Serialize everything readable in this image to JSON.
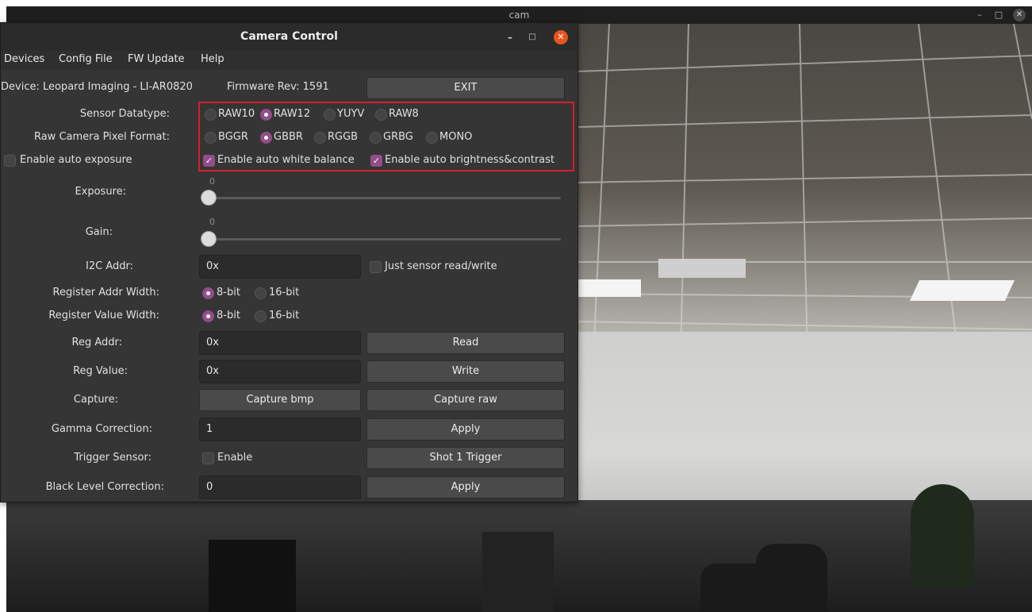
{
  "cam_window": {
    "title": "cam",
    "min_glyph": "–",
    "max_glyph": "□",
    "close_glyph": "✕"
  },
  "dialog": {
    "title": "Camera Control",
    "min_glyph": "–",
    "max_glyph": "□",
    "close_glyph": "✕"
  },
  "menu": [
    "Devices",
    "Config File",
    "FW Update",
    "Help"
  ],
  "device_info": {
    "device": "Device: Leopard Imaging - LI-AR0820",
    "firmware": "Firmware Rev: 1591",
    "exit_label": "EXIT"
  },
  "sensor_datatype": {
    "label": "Sensor Datatype:",
    "options": [
      "RAW10",
      "RAW12",
      "YUYV",
      "RAW8"
    ],
    "selected": "RAW12"
  },
  "pixel_format": {
    "label": "Raw Camera Pixel Format:",
    "options": [
      "BGGR",
      "GBBR",
      "RGGB",
      "GRBG",
      "MONO"
    ],
    "selected": "GBBR"
  },
  "auto": {
    "exposure_label": "Enable auto exposure",
    "exposure_checked": false,
    "white_balance_label": "Enable auto white balance",
    "white_balance_checked": true,
    "brightness_label": "Enable auto brightness&contrast",
    "brightness_checked": true
  },
  "exposure": {
    "label": "Exposure:",
    "value": "0",
    "fraction": 0.0
  },
  "gain": {
    "label": "Gain:",
    "value": "0",
    "fraction": 0.0
  },
  "i2c": {
    "label": "I2C Addr:",
    "value": "0x",
    "sensor_only_label": "Just sensor read/write",
    "sensor_only_checked": false
  },
  "reg_addr_width": {
    "label": "Register Addr Width:",
    "options": [
      "8-bit",
      "16-bit"
    ],
    "selected": "8-bit"
  },
  "reg_value_width": {
    "label": "Register Value Width:",
    "options": [
      "8-bit",
      "16-bit"
    ],
    "selected": "8-bit"
  },
  "reg_addr": {
    "label": "Reg Addr:",
    "value": "0x",
    "button": "Read"
  },
  "reg_value": {
    "label": "Reg Value:",
    "value": "0x",
    "button": "Write"
  },
  "capture": {
    "label": "Capture:",
    "bmp_button": "Capture bmp",
    "raw_button": "Capture raw"
  },
  "gamma": {
    "label": "Gamma Correction:",
    "value": "1",
    "button": "Apply"
  },
  "trigger": {
    "label": "Trigger Sensor:",
    "enable_label": "Enable",
    "enable_checked": false,
    "button": "Shot 1 Trigger"
  },
  "black_level": {
    "label": "Black Level Correction:",
    "value": "0",
    "button": "Apply"
  },
  "colors": {
    "accent": "#924d8b",
    "close": "#e95420",
    "highlight": "#d4202c"
  }
}
